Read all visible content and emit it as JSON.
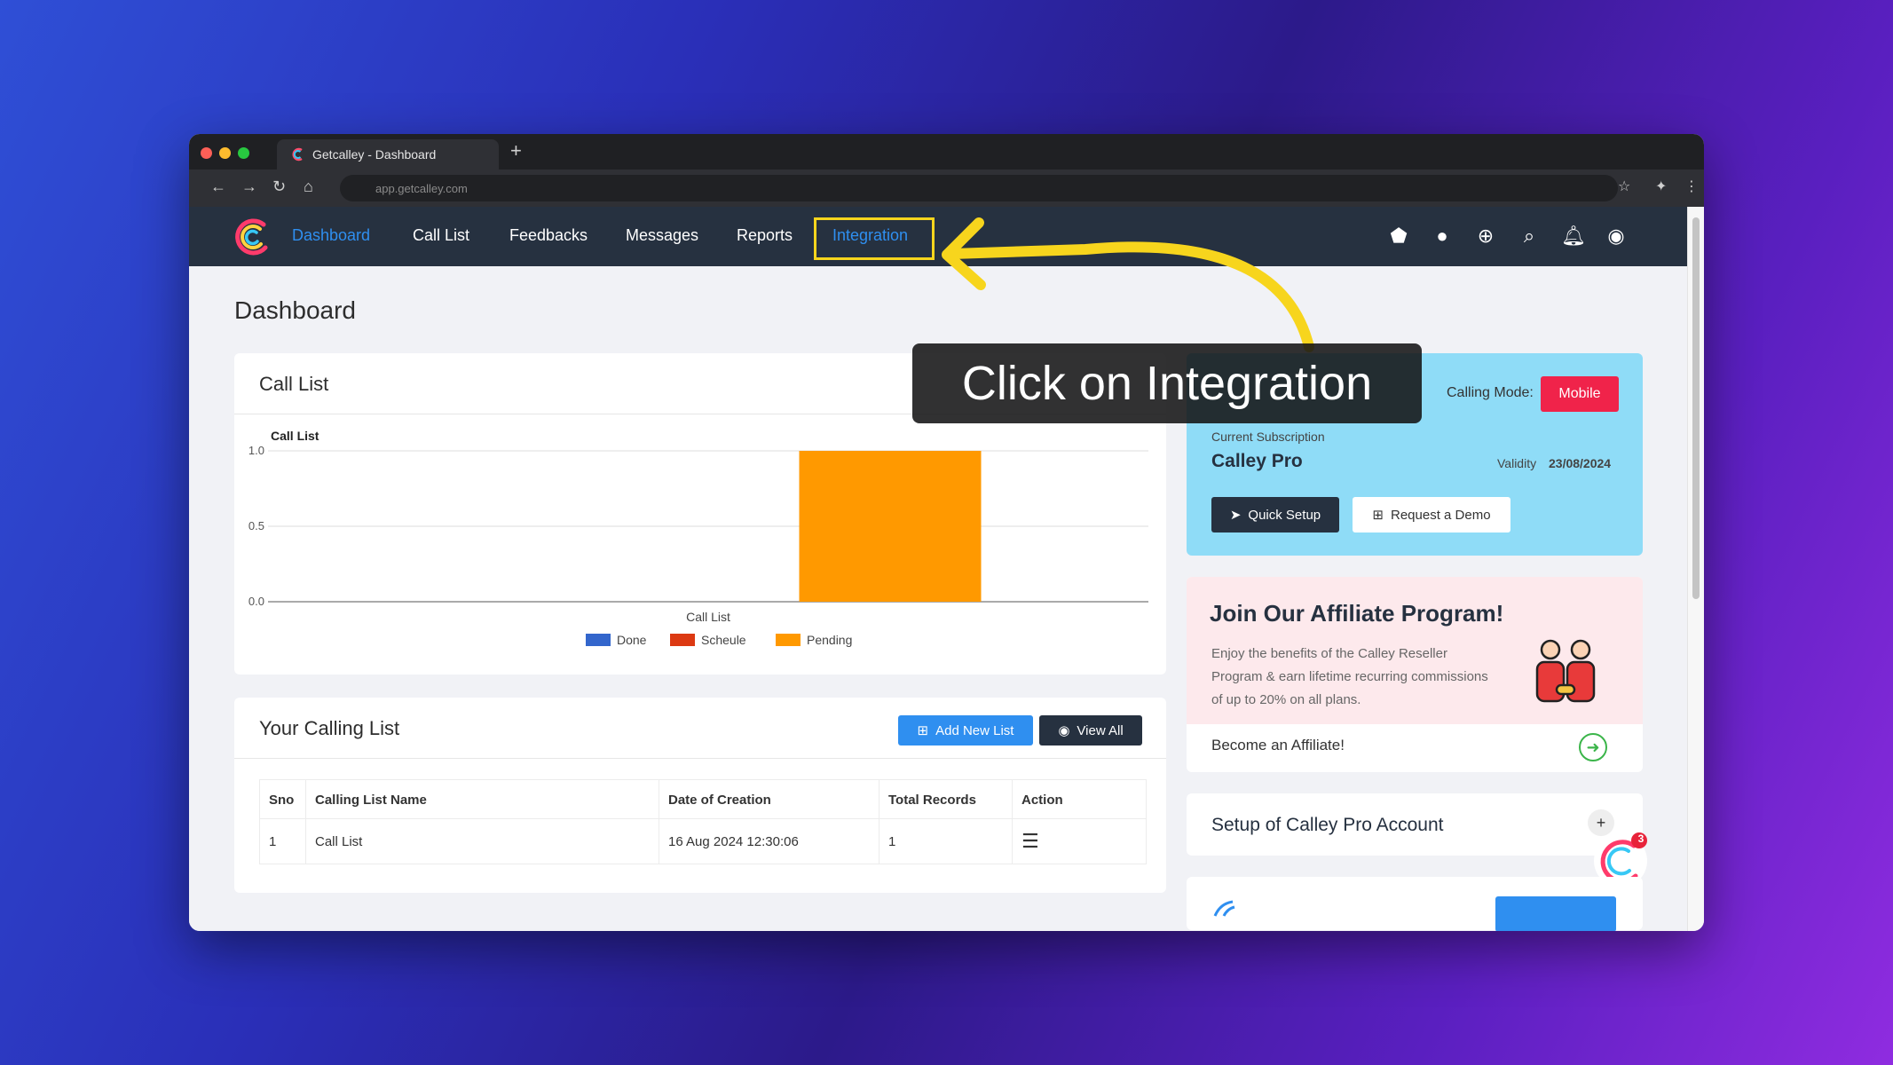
{
  "browser": {
    "tab_title": "Getcalley - Dashboard",
    "new_tab": "+",
    "url": "app.getcalley.com"
  },
  "nav": {
    "items": [
      {
        "label": "Dashboard",
        "active": true
      },
      {
        "label": "Call List"
      },
      {
        "label": "Feedbacks"
      },
      {
        "label": "Messages"
      },
      {
        "label": "Reports"
      },
      {
        "label": "Integration",
        "highlighted": true
      }
    ],
    "icons": [
      "android-icon",
      "apple-icon",
      "support-icon",
      "search-icon",
      "bell-icon",
      "user-icon"
    ]
  },
  "page_title": "Dashboard",
  "callout": "Click on Integration",
  "call_list_card": {
    "title": "Call List"
  },
  "chart_data": {
    "type": "bar",
    "title": "Call List",
    "categories": [
      "Call List"
    ],
    "series": [
      {
        "name": "Done",
        "values": [
          0
        ],
        "color": "#3366cc"
      },
      {
        "name": "Scheule",
        "values": [
          0
        ],
        "color": "#dc3912"
      },
      {
        "name": "Pending",
        "values": [
          1
        ],
        "color": "#ff9900"
      }
    ],
    "yticks": [
      "1.0",
      "0.5",
      "0.0"
    ],
    "ylim": [
      0,
      1
    ],
    "legend": "bottom",
    "grid": true
  },
  "subscription": {
    "calling_mode_label": "Calling Mode:",
    "calling_mode_value": "Mobile",
    "current_label": "Current Subscription",
    "plan": "Calley Pro",
    "validity_label": "Validity",
    "validity_date": "23/08/2024",
    "quick_setup": "Quick Setup",
    "request_demo": "Request a Demo"
  },
  "affiliate": {
    "title": "Join Our Affiliate Program!",
    "body": "Enjoy the benefits of the Calley Reseller Program & earn lifetime recurring commissions of up to 20% on all plans.",
    "link": "Become an Affiliate!"
  },
  "setup": {
    "title": "Setup of Calley Pro Account",
    "badge_count": "3"
  },
  "calling_list": {
    "title": "Your Calling List",
    "add_new": "Add New List",
    "view_all": "View All",
    "columns": [
      "Sno",
      "Calling List Name",
      "Date of Creation",
      "Total Records",
      "Action"
    ],
    "rows": [
      {
        "sno": "1",
        "name": "Call List",
        "date": "16 Aug 2024 12:30:06",
        "records": "1"
      }
    ]
  },
  "colors": {
    "nav_bg": "#263140",
    "accent_blue": "#2f8ff0",
    "highlight": "#f7d51d",
    "mobile_btn": "#f0234a",
    "subscription_bg": "#8fdcf7",
    "affiliate_bg": "#fde9ec"
  }
}
